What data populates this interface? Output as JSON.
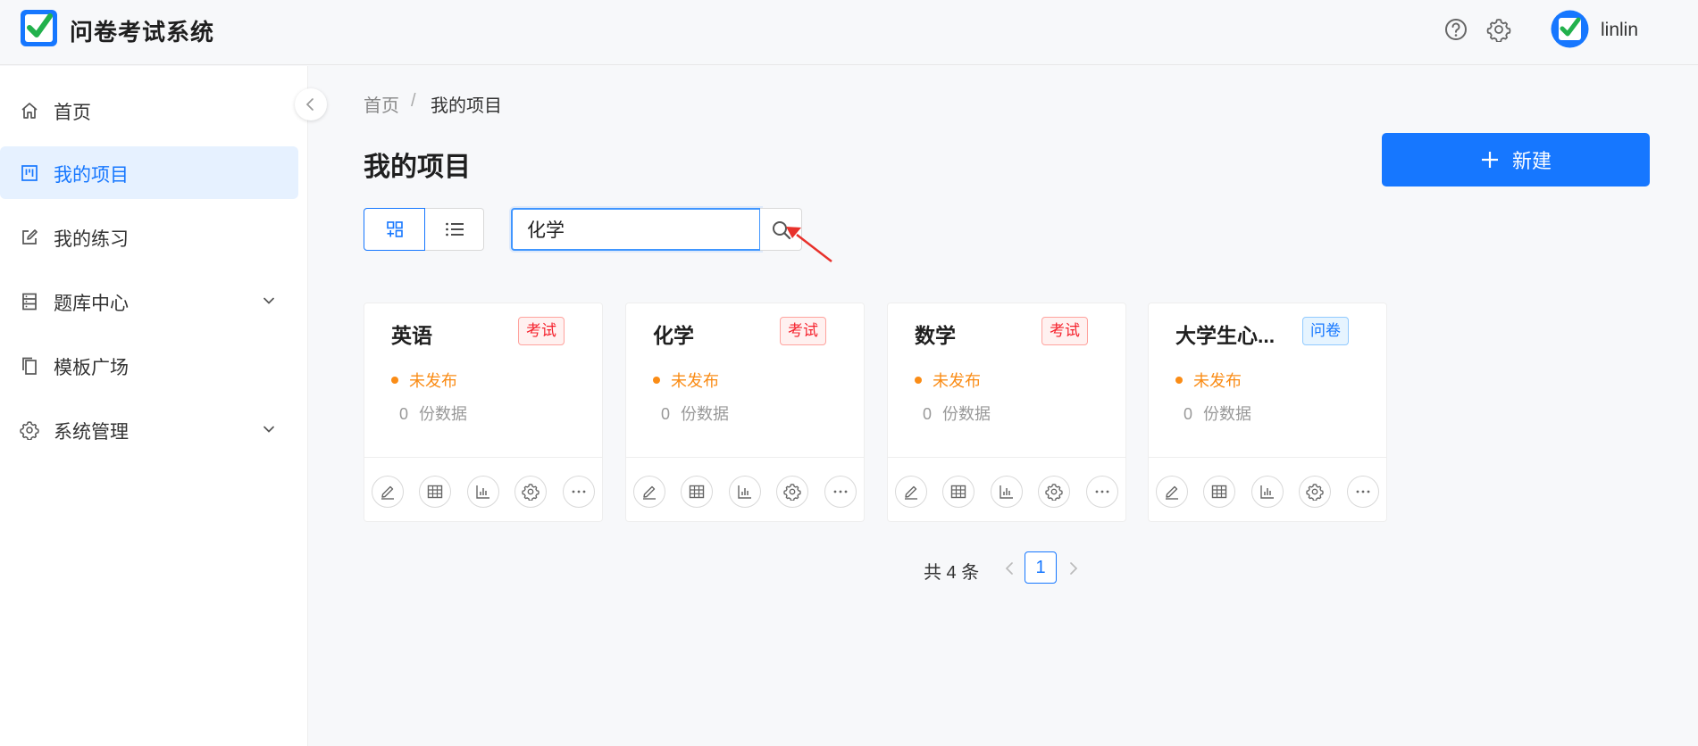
{
  "app": {
    "title": "问卷考试系统"
  },
  "header": {
    "user_name": "linlin"
  },
  "sidebar": {
    "items": [
      {
        "label": "首页"
      },
      {
        "label": "我的项目"
      },
      {
        "label": "我的练习"
      },
      {
        "label": "题库中心"
      },
      {
        "label": "模板广场"
      },
      {
        "label": "系统管理"
      }
    ]
  },
  "breadcrumb": {
    "home": "首页",
    "separator": "/",
    "current": "我的项目"
  },
  "page": {
    "title": "我的项目",
    "new_button": "新建"
  },
  "search": {
    "value": "化学"
  },
  "cards": [
    {
      "title": "英语",
      "tag": "考试",
      "status": "未发布",
      "count": "0",
      "count_label": "份数据"
    },
    {
      "title": "化学",
      "tag": "考试",
      "status": "未发布",
      "count": "0",
      "count_label": "份数据"
    },
    {
      "title": "数学",
      "tag": "考试",
      "status": "未发布",
      "count": "0",
      "count_label": "份数据"
    },
    {
      "title": "大学生心...",
      "tag": "问卷",
      "status": "未发布",
      "count": "0",
      "count_label": "份数据"
    }
  ],
  "pagination": {
    "total": "共 4 条",
    "current_page": "1"
  },
  "colors": {
    "primary": "#1677ff",
    "exam_tag": "#f5222d",
    "survey_tag": "#1677ff",
    "status": "#fa8c16",
    "active_bg": "#e6f1ff"
  }
}
